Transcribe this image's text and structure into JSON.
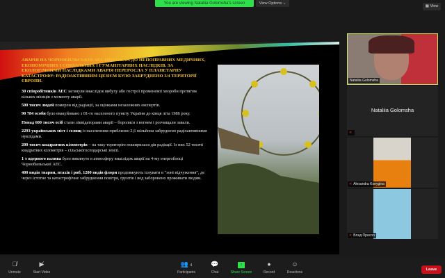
{
  "banner": {
    "text": "You are viewing Nataliia Golomsha's screen",
    "view_options": "View Options ⌄"
  },
  "view_button": "View",
  "slide": {
    "title": "Аварія на Чорнобильській АЕС призвела до непоправних медичних, економічних і соціальних і гуманітарних наслідків. За екологічними наслідками аварія переросла у планетарну катастрофу: радіоактивним цезієм було забруднено 3/4 території Європи.",
    "paragraphs": [
      {
        "bold": "30 співробітників АЕС",
        "text": " загинули внаслідок вибуху або гострої променевої хвороби протягом кількох місяців з моменту аварії."
      },
      {
        "bold": "500 тисяч людей",
        "text": " померли від радіації, за оцінками незалежних експертів."
      },
      {
        "bold": "90 784 особи",
        "text": " було евакуйовано з 81-го населеного пункту України до кінця літа 1986 року."
      },
      {
        "bold": "Понад 600 тисяч осіб",
        "text": " стали ліквідаторами аварії – боролися з вогнем і розчищали завали."
      },
      {
        "bold": "2293 українських міст і селищ",
        "text": " із населенням приблизно 2,6 мільйона забруднено радіоактивними нуклідами."
      },
      {
        "bold": "200 тисяч квадратних кілометрів",
        "text": " – на таку територію поширилася дія радіації. Із них 52 тисячі квадратних кілометрів – сільськогосподарські землі."
      },
      {
        "bold": "1 т ядерного палива",
        "text": " було викинуто в атмосферу внаслідок аварії на 4-му енергоблоці Чорнобильської АЕС."
      },
      {
        "bold": "400 видів тварин, птахів і риб, 1200 видів флори",
        "text": " продовжують існувати в \"зоні відчуження\", де через істотне та катастрофічне забруднення повітря, ґрунтів і вод заборонено проживати людям."
      }
    ]
  },
  "participants": [
    {
      "name": "Nataliia Golomsha",
      "type": "video-active"
    },
    {
      "name": "Nataliia Golomsha",
      "type": "name-only"
    },
    {
      "name": "Alexandra Konygina",
      "type": "video"
    },
    {
      "name": "Влад Прасол",
      "type": "video"
    }
  ],
  "toolbar": {
    "unmute": "Unmute",
    "start_video": "Start Video",
    "participants": "Participants",
    "participants_count": "4",
    "chat": "Chat",
    "share_screen": "Share Screen",
    "record": "Record",
    "reactions": "Reactions",
    "leave": "Leave"
  },
  "colors": {
    "share_green": "#2fe04a",
    "leave_red": "#c8101a",
    "title_gold": "#f2c030"
  }
}
